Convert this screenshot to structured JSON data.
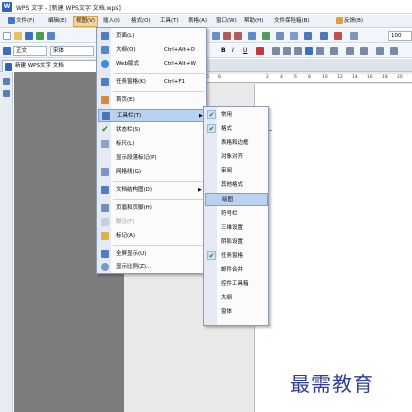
{
  "window": {
    "app_badge": "W",
    "title": "WPS 文字 - [新建 WPS文字 文档.wps]"
  },
  "menubar": {
    "items": [
      {
        "label": "文件(F)"
      },
      {
        "label": "编辑(E)"
      },
      {
        "label": "视图(V)"
      },
      {
        "label": "插入(I)"
      },
      {
        "label": "格式(O)"
      },
      {
        "label": "工具(T)"
      },
      {
        "label": "表格(A)"
      },
      {
        "label": "窗口(W)"
      },
      {
        "label": "帮助(H)"
      },
      {
        "label": "文件保险箱(B)"
      },
      {
        "label": "反馈(B)"
      }
    ]
  },
  "toolbar2": {
    "style_combo": "正文",
    "font_combo": "宋体",
    "bold": "B",
    "italic": "I",
    "underline": "U",
    "zoom": "100"
  },
  "tabs": {
    "document_tab": "新建 WPS文字 文档"
  },
  "ruler_ticks": [
    "6",
    "8",
    "2",
    "4",
    "6",
    "8",
    "10",
    "12",
    "14",
    "16",
    "18",
    "20"
  ],
  "view_menu": {
    "items": [
      {
        "label": "页面(L)",
        "shortcut": ""
      },
      {
        "label": "大纲(O)",
        "shortcut": "Ctrl+Alt+O"
      },
      {
        "label": "Web版式",
        "shortcut": "Ctrl+Alt+W"
      },
      {
        "label": "任务窗格(K)",
        "shortcut": "Ctrl+F1"
      },
      {
        "label": "首页(E)",
        "shortcut": ""
      },
      {
        "label": "工具栏(T)",
        "shortcut": ""
      },
      {
        "label": "状态栏(S)",
        "shortcut": ""
      },
      {
        "label": "标尺(L)",
        "shortcut": ""
      },
      {
        "label": "显示段落标记(P)",
        "shortcut": ""
      },
      {
        "label": "网格线(G)",
        "shortcut": ""
      },
      {
        "label": "文档结构图(D)",
        "shortcut": ""
      },
      {
        "label": "页眉和页脚(H)",
        "shortcut": ""
      },
      {
        "label": "脚注(F)",
        "shortcut": ""
      },
      {
        "label": "标记(A)",
        "shortcut": ""
      },
      {
        "label": "全屏显示(U)",
        "shortcut": ""
      },
      {
        "label": "显示比例(Z)...",
        "shortcut": ""
      }
    ]
  },
  "toolbar_submenu": {
    "items": [
      {
        "label": "常用",
        "checked": true
      },
      {
        "label": "格式",
        "checked": true
      },
      {
        "label": "表格和边框",
        "checked": false
      },
      {
        "label": "对象对齐",
        "checked": false
      },
      {
        "label": "审阅",
        "checked": false
      },
      {
        "label": "其他格式",
        "checked": false
      },
      {
        "label": "绘图",
        "checked": false
      },
      {
        "label": "符号栏",
        "checked": false
      },
      {
        "label": "三维设置",
        "checked": false
      },
      {
        "label": "阴影设置",
        "checked": false
      },
      {
        "label": "任务窗格",
        "checked": true
      },
      {
        "label": "邮件合并",
        "checked": false
      },
      {
        "label": "控件工具箱",
        "checked": false
      },
      {
        "label": "大纲",
        "checked": false
      },
      {
        "label": "窗体",
        "checked": false
      }
    ],
    "check_mark": "✔"
  },
  "watermark": "最需教育",
  "colors": {
    "menu_highlight": "#b9d2f2",
    "active_menu": "#f7d59a",
    "accent": "#2a63b8",
    "watermark": "#2c3f94"
  }
}
